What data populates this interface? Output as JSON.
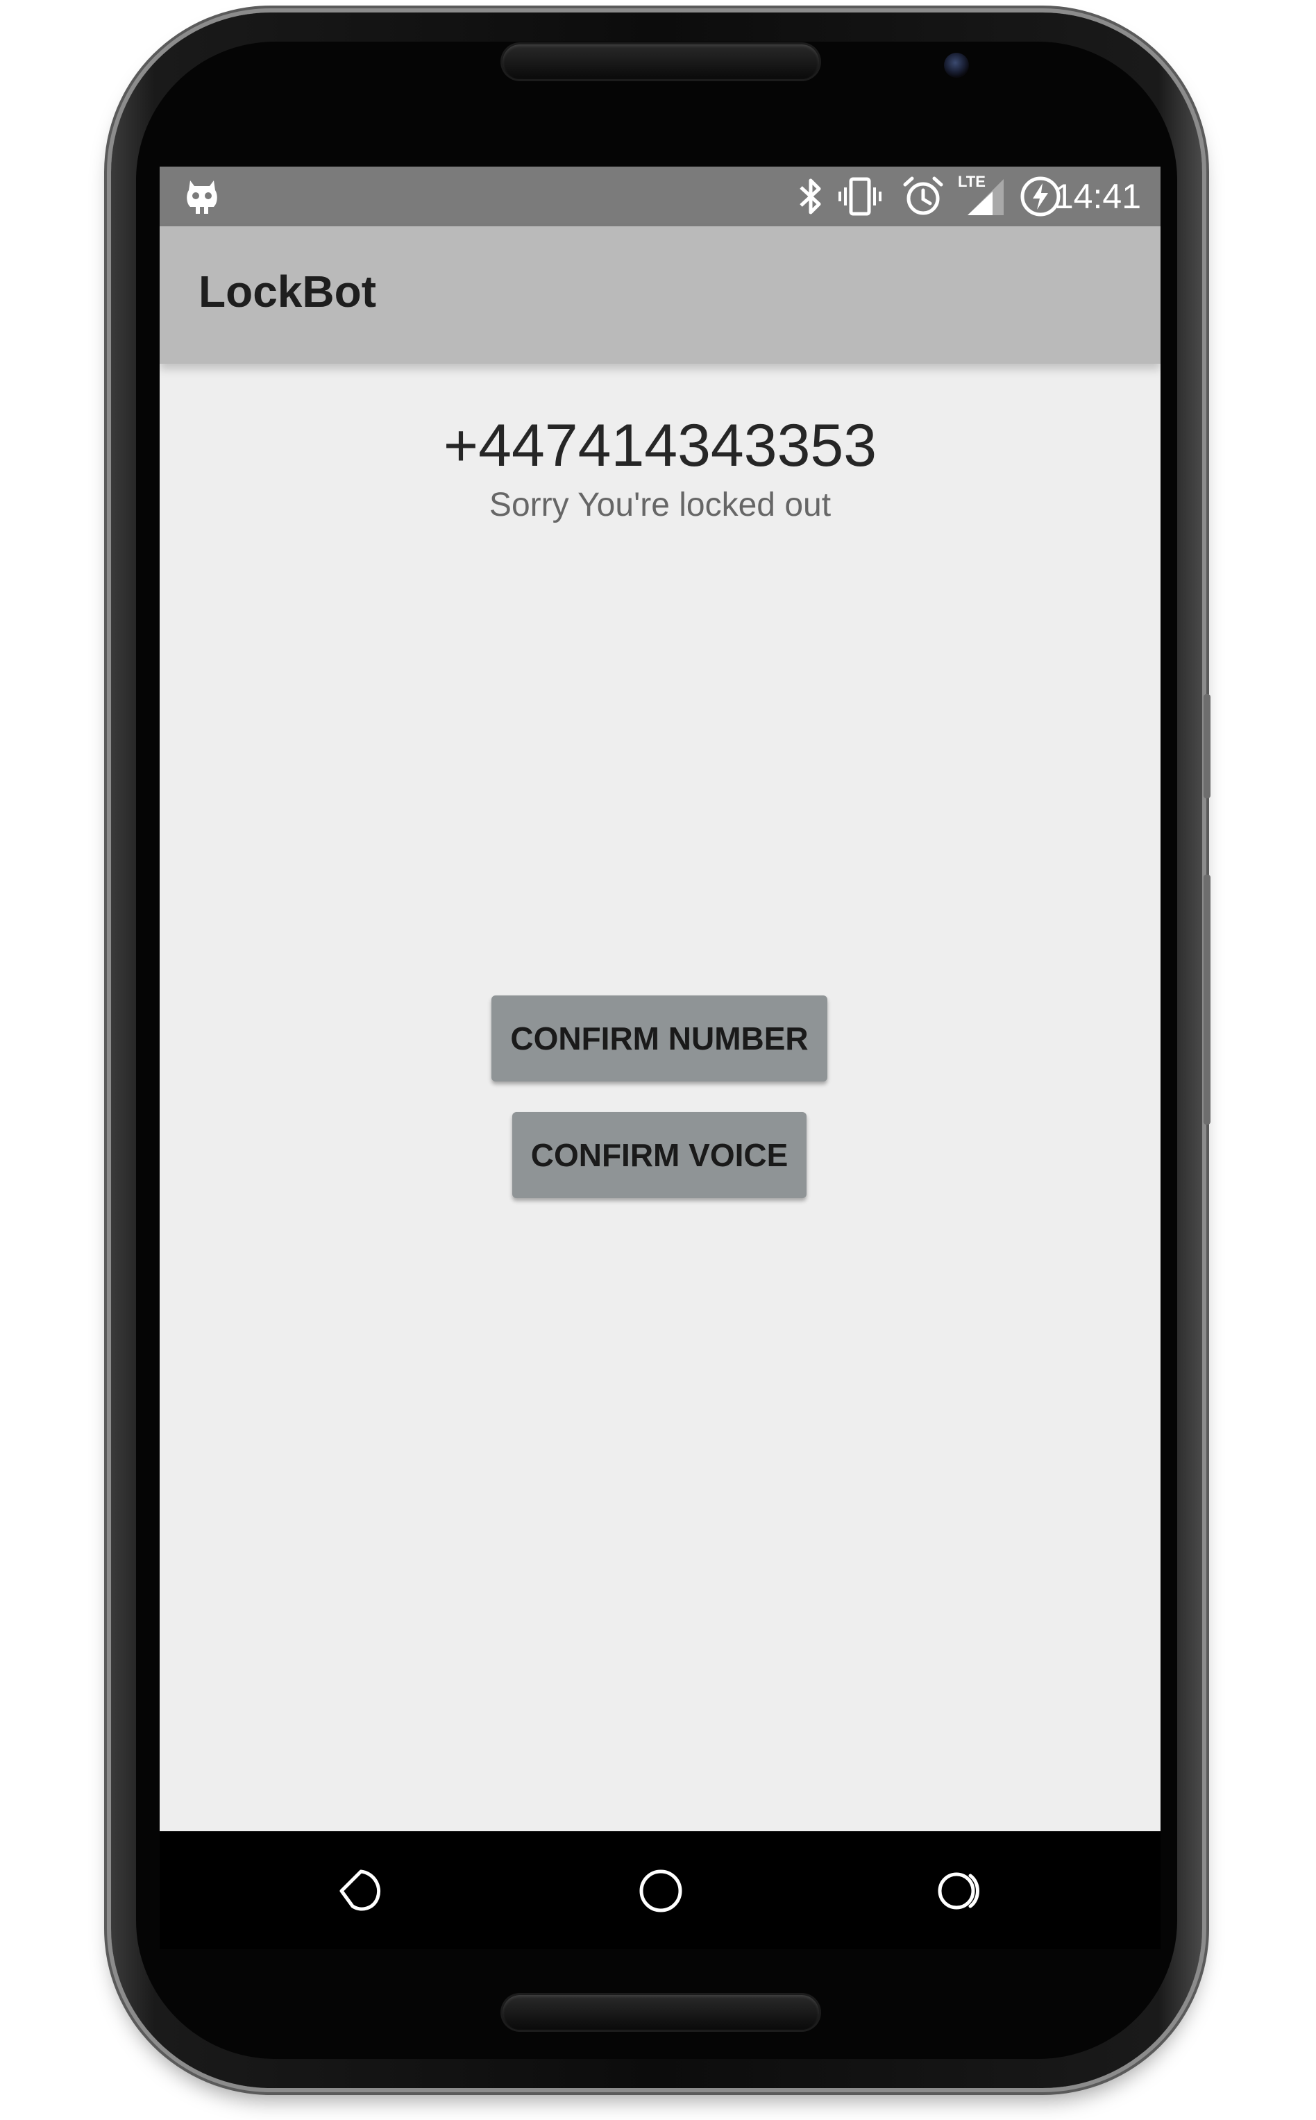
{
  "status_bar": {
    "time": "14:41",
    "icons": [
      "cyanogen-mascot-icon",
      "bluetooth-icon",
      "vibrate-icon",
      "alarm-icon",
      "lte-signal-icon",
      "battery-charging-icon"
    ],
    "network_label": "LTE"
  },
  "app_bar": {
    "title": "LockBot"
  },
  "main": {
    "phone_number": "+447414343353",
    "message": "Sorry You're locked out",
    "buttons": {
      "confirm_number": "CONFIRM NUMBER",
      "confirm_voice": "CONFIRM VOICE"
    }
  },
  "nav_bar": {
    "icons": [
      "back-icon",
      "home-icon",
      "recents-icon"
    ]
  },
  "colors": {
    "status_bar": "#7b7b7b",
    "app_bar": "#bababa",
    "screen_background": "#eeeeee",
    "button": "#8f9496"
  }
}
